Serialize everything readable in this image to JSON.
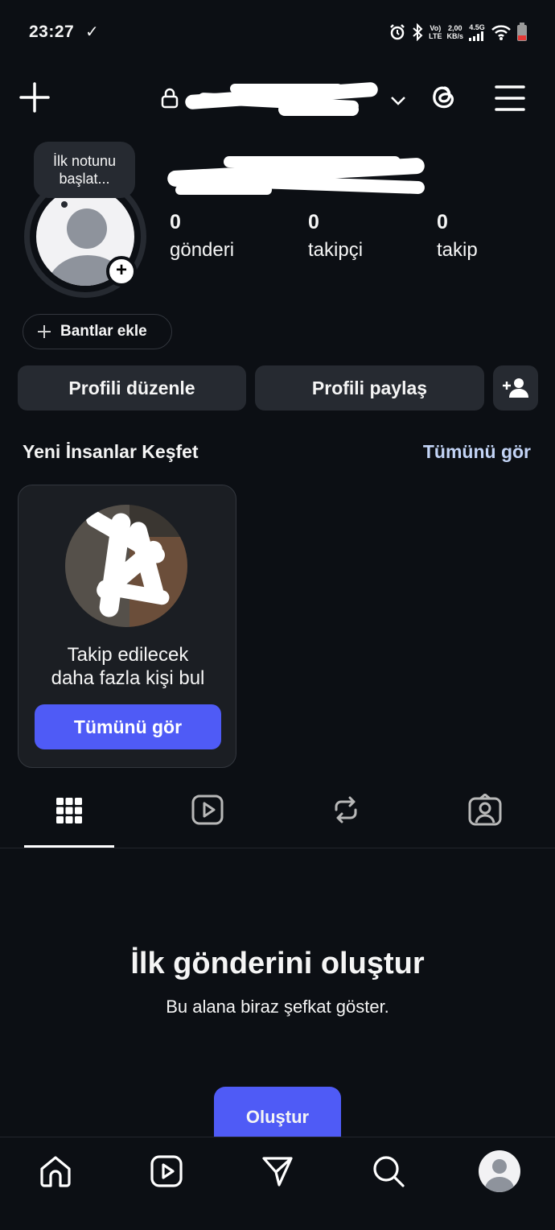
{
  "status": {
    "time": "23:27",
    "check": "✓",
    "network_top": "Vo)",
    "network_bottom": "LTE",
    "speed_top": "2,00",
    "speed_bottom": "KB/s",
    "signal_label": "4.5G"
  },
  "note": {
    "text": "İlk notunu başlat..."
  },
  "stats": [
    {
      "value": "0",
      "label": "gönderi"
    },
    {
      "value": "0",
      "label": "takipçi"
    },
    {
      "value": "0",
      "label": "takip"
    }
  ],
  "bands": {
    "label": "Bantlar ekle"
  },
  "actions": {
    "edit": "Profili düzenle",
    "share": "Profili paylaş"
  },
  "discover": {
    "title": "Yeni İnsanlar Keşfet",
    "see_all": "Tümünü gör",
    "card_text_line1": "Takip edilecek",
    "card_text_line2": "daha fazla kişi bul",
    "card_button": "Tümünü gör"
  },
  "tabs": [
    "grid-icon",
    "reels-icon",
    "reposts-icon",
    "tagged-icon"
  ],
  "empty": {
    "title": "İlk gönderini oluştur",
    "subtitle": "Bu alana biraz şefkat göster.",
    "button": "Oluştur"
  },
  "nav": [
    "home-icon",
    "reels-icon",
    "messages-icon",
    "search-icon",
    "profile-avatar"
  ],
  "colors": {
    "accent": "#4f5bf6",
    "link": "#c3d4f6",
    "background": "#0c0f14",
    "button": "#262a31"
  }
}
